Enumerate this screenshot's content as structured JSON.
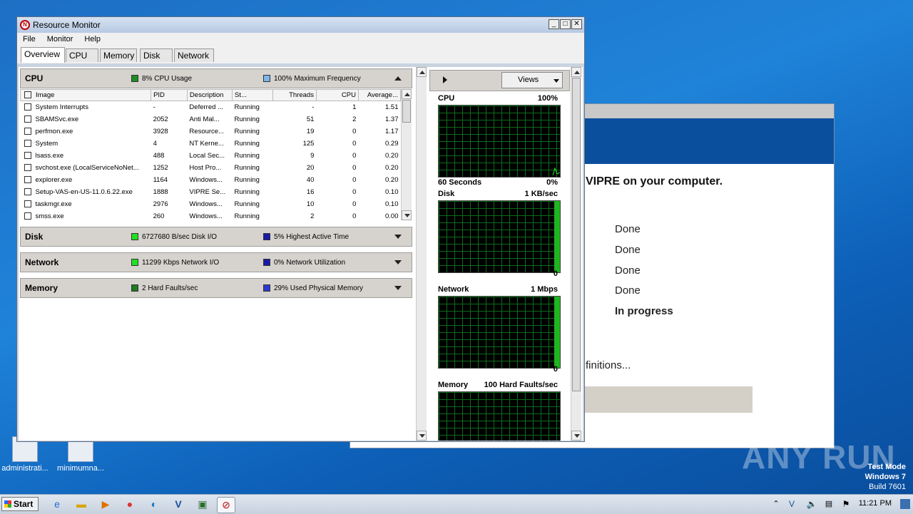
{
  "desktop": {
    "icons": [
      {
        "label": "administrati..."
      },
      {
        "label": "minimumna..."
      }
    ]
  },
  "vipre": {
    "message": "VIPRE on your computer.",
    "steps": [
      "Done",
      "Done",
      "Done",
      "Done"
    ],
    "current_step": "In progress",
    "definitions_text": "finitions..."
  },
  "window": {
    "title": "Resource Monitor",
    "menu": [
      "File",
      "Monitor",
      "Help"
    ],
    "tabs": [
      "Overview",
      "CPU",
      "Memory",
      "Disk",
      "Network"
    ],
    "active_tab": "Overview"
  },
  "sections": {
    "cpu": {
      "name": "CPU",
      "stat1": "8% CPU Usage",
      "stat1_color": "#1e8c24",
      "stat2": "100% Maximum Frequency",
      "stat2_color": "#7cb6ea"
    },
    "disk": {
      "name": "Disk",
      "stat1": "6727680 B/sec Disk I/O",
      "stat1_color": "#22e022",
      "stat2": "5% Highest Active Time",
      "stat2_color": "#1a1aa8"
    },
    "network": {
      "name": "Network",
      "stat1": "11299 Kbps Network I/O",
      "stat1_color": "#22e022",
      "stat2": "0% Network Utilization",
      "stat2_color": "#1a1aa8"
    },
    "memory": {
      "name": "Memory",
      "stat1": "2 Hard Faults/sec",
      "stat1_color": "#1e7a24",
      "stat2": "29% Used Physical Memory",
      "stat2_color": "#2a3ad0"
    }
  },
  "cpu_table": {
    "headers": [
      "Image",
      "PID",
      "Description",
      "St...",
      "Threads",
      "CPU",
      "Average..."
    ],
    "rows": [
      [
        "System Interrupts",
        "-",
        "Deferred ...",
        "Running",
        "-",
        "1",
        "1.51"
      ],
      [
        "SBAMSvc.exe",
        "2052",
        "Anti Mal...",
        "Running",
        "51",
        "2",
        "1.37"
      ],
      [
        "perfmon.exe",
        "3928",
        "Resource...",
        "Running",
        "19",
        "0",
        "1.17"
      ],
      [
        "System",
        "4",
        "NT Kerne...",
        "Running",
        "125",
        "0",
        "0.29"
      ],
      [
        "lsass.exe",
        "488",
        "Local Sec...",
        "Running",
        "9",
        "0",
        "0.20"
      ],
      [
        "svchost.exe (LocalServiceNoNet...",
        "1252",
        "Host Pro...",
        "Running",
        "20",
        "0",
        "0.20"
      ],
      [
        "explorer.exe",
        "1164",
        "Windows...",
        "Running",
        "40",
        "0",
        "0.20"
      ],
      [
        "Setup-VAS-en-US-11.0.6.22.exe",
        "1888",
        "VIPRE Se...",
        "Running",
        "16",
        "0",
        "0.10"
      ],
      [
        "taskmgr.exe",
        "2976",
        "Windows...",
        "Running",
        "10",
        "0",
        "0.10"
      ],
      [
        "smss.exe",
        "260",
        "Windows...",
        "Running",
        "2",
        "0",
        "0.00"
      ]
    ]
  },
  "graphs": {
    "views_label": "Views",
    "cpu": {
      "title": "CPU",
      "max": "100%",
      "footer_left": "60 Seconds",
      "footer_right": "0%"
    },
    "disk": {
      "title": "Disk",
      "max": "1 KB/sec",
      "footer_right": "0"
    },
    "network": {
      "title": "Network",
      "max": "1 Mbps",
      "footer_right": "0"
    },
    "memory": {
      "title": "Memory",
      "max": "100 Hard Faults/sec"
    }
  },
  "taskbar": {
    "start": "Start",
    "time": "11:21 PM"
  },
  "watermark": {
    "line1": "Test Mode",
    "line2": "Windows 7",
    "line3": "Build 7601",
    "brand": "ANY RUN"
  }
}
